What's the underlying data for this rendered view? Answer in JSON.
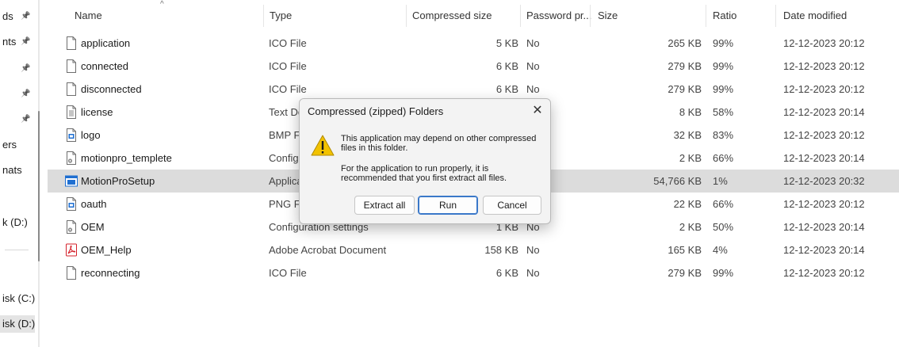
{
  "nav": {
    "items": [
      {
        "label": "ds",
        "pinned": true
      },
      {
        "label": "nts",
        "pinned": true
      },
      {
        "label": "",
        "pinned": true
      },
      {
        "label": "",
        "pinned": true
      },
      {
        "label": "",
        "pinned": true
      },
      {
        "label": "ers",
        "pinned": false
      },
      {
        "label": "nats",
        "pinned": false
      },
      {
        "label": "k (D:)",
        "pinned": false
      },
      {
        "label": "isk (C:)",
        "pinned": false
      },
      {
        "label": "isk (D:)",
        "pinned": false
      }
    ]
  },
  "columns": {
    "name": "Name",
    "type": "Type",
    "compressed_size": "Compressed size",
    "password": "Password pr...",
    "size": "Size",
    "ratio": "Ratio",
    "date_modified": "Date modified"
  },
  "rows": [
    {
      "name": "application",
      "type": "ICO File",
      "csize": "5 KB",
      "pw": "No",
      "size": "265 KB",
      "ratio": "99%",
      "date": "12-12-2023 20:12",
      "icon": "file-icon"
    },
    {
      "name": "connected",
      "type": "ICO File",
      "csize": "6 KB",
      "pw": "No",
      "size": "279 KB",
      "ratio": "99%",
      "date": "12-12-2023 20:12",
      "icon": "file-icon"
    },
    {
      "name": "disconnected",
      "type": "ICO File",
      "csize": "6 KB",
      "pw": "No",
      "size": "279 KB",
      "ratio": "99%",
      "date": "12-12-2023 20:12",
      "icon": "file-icon"
    },
    {
      "name": "license",
      "type": "Text Do",
      "csize": "",
      "pw": "",
      "size": "8 KB",
      "ratio": "58%",
      "date": "12-12-2023 20:14",
      "icon": "text-file-icon"
    },
    {
      "name": "logo",
      "type": "BMP Fil",
      "csize": "",
      "pw": "",
      "size": "32 KB",
      "ratio": "83%",
      "date": "12-12-2023 20:12",
      "icon": "image-file-icon"
    },
    {
      "name": "motionpro_templete",
      "type": "Configu",
      "csize": "",
      "pw": "",
      "size": "2 KB",
      "ratio": "66%",
      "date": "12-12-2023 20:14",
      "icon": "config-file-icon"
    },
    {
      "name": "MotionProSetup",
      "type": "Applica",
      "csize": "",
      "pw": "",
      "size": "54,766 KB",
      "ratio": "1%",
      "date": "12-12-2023 20:32",
      "icon": "application-icon",
      "selected": true
    },
    {
      "name": "oauth",
      "type": "PNG Fil",
      "csize": "",
      "pw": "",
      "size": "22 KB",
      "ratio": "66%",
      "date": "12-12-2023 20:12",
      "icon": "image-file-icon"
    },
    {
      "name": "OEM",
      "type": "Configuration settings",
      "csize": "1 KB",
      "pw": "No",
      "size": "2 KB",
      "ratio": "50%",
      "date": "12-12-2023 20:14",
      "icon": "config-file-icon"
    },
    {
      "name": "OEM_Help",
      "type": "Adobe Acrobat Document",
      "csize": "158 KB",
      "pw": "No",
      "size": "165 KB",
      "ratio": "4%",
      "date": "12-12-2023 20:14",
      "icon": "pdf-icon"
    },
    {
      "name": "reconnecting",
      "type": "ICO File",
      "csize": "6 KB",
      "pw": "No",
      "size": "279 KB",
      "ratio": "99%",
      "date": "12-12-2023 20:12",
      "icon": "file-icon"
    }
  ],
  "dialog": {
    "title": "Compressed (zipped) Folders",
    "close_glyph": "✕",
    "message1": "This application may depend on other compressed files in this folder.",
    "message2": "For the application to run properly, it is recommended that you first extract all files.",
    "extract_label": "Extract all",
    "run_label": "Run",
    "cancel_label": "Cancel",
    "icon": "warning-icon"
  },
  "colors": {
    "selected_row": "#dcdcdc",
    "accent": "#3a78c9",
    "warning": "#f2c200",
    "pdf": "#d4202a",
    "image_blue": "#1f6fd1"
  }
}
